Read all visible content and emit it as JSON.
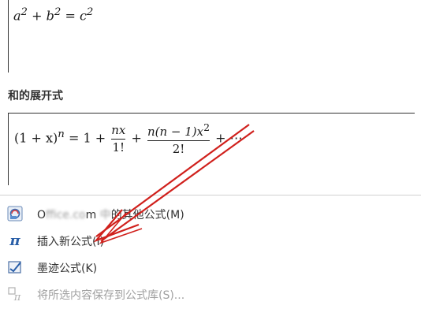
{
  "formulas": {
    "pythagorean": {
      "a": "a",
      "b": "b",
      "c": "c",
      "sup": "2",
      "plus": "+",
      "equals": "="
    },
    "section_title": "和的展开式",
    "binomial": {
      "lhs": "(1 + x)",
      "lhs_exp": "n",
      "eq_one_plus": "= 1 +",
      "frac1_num": "nx",
      "frac1_den": "1!",
      "plus": "+",
      "frac2_num": "n(n − 1)x",
      "frac2_num_sup": "2",
      "frac2_den": "2!",
      "tail": "+ ⋯"
    }
  },
  "menu": {
    "items": [
      {
        "icon": "office-formulas-icon",
        "label_prefix": "O",
        "label_blurred": "ffice.co",
        "label_mid": "m",
        "label_blurred2": "中",
        "label_suffix": "的其他公式(M)",
        "enabled": true
      },
      {
        "icon": "pi-icon",
        "label": "插入新公式(I)",
        "enabled": true
      },
      {
        "icon": "ink-equation-icon",
        "label": "墨迹公式(K)",
        "enabled": true
      },
      {
        "icon": "save-to-gallery-icon",
        "label": "将所选内容保存到公式库(S)...",
        "enabled": false
      }
    ]
  },
  "colors": {
    "annotation_arrow": "#d0201c",
    "pi_icon": "#2a5fa8",
    "disabled_text": "#a0a0a0"
  }
}
